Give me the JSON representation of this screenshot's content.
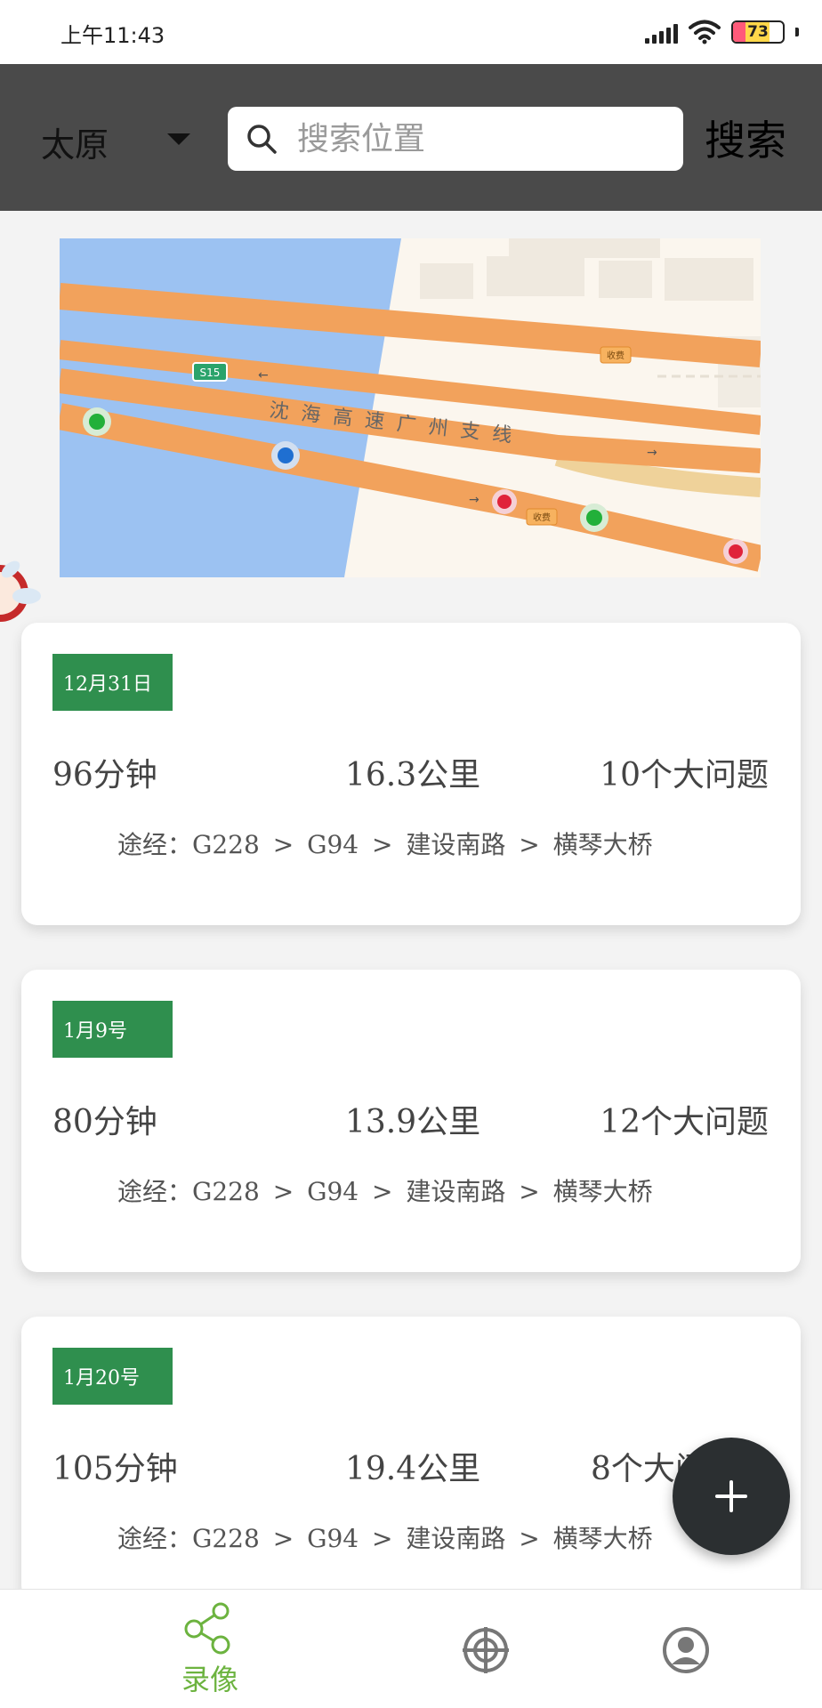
{
  "status_bar": {
    "time": "上午11:43",
    "battery": "73"
  },
  "header": {
    "city": "太原",
    "search_placeholder": "搜索位置",
    "search_button": "搜索"
  },
  "map": {
    "road_label": "沈海高速广州支线",
    "shield_label": "S15",
    "toll_label_1": "收费",
    "toll_label_2": "收费"
  },
  "trips": [
    {
      "date": "12月31日",
      "duration": "96分钟",
      "distance": "16.3公里",
      "issues": "10个大问题",
      "route": "途经：G228 > G94 > 建设南路 > 横琴大桥"
    },
    {
      "date": "1月9号",
      "duration": "80分钟",
      "distance": "13.9公里",
      "issues": "12个大问题",
      "route": "途经：G228 > G94 > 建设南路 > 横琴大桥"
    },
    {
      "date": "1月20号",
      "duration": "105分钟",
      "distance": "19.4公里",
      "issues": "8个大问题",
      "route": "途经：G228 > G94 > 建设南路 > 横琴大桥"
    }
  ],
  "fab": {
    "icon": "plus-icon"
  },
  "bottom_nav": {
    "items": [
      {
        "label": "录像",
        "icon": "share-nodes-icon",
        "active": true,
        "color": "#6cb33f"
      },
      {
        "label": "",
        "icon": "crosshair-icon",
        "active": false
      },
      {
        "label": "",
        "icon": "user-icon",
        "active": false
      }
    ]
  },
  "colors": {
    "header_bg": "#4a4a4a",
    "date_badge": "#2f8f4e",
    "active_nav": "#6cb33f",
    "fab_bg": "#2b2f31"
  }
}
